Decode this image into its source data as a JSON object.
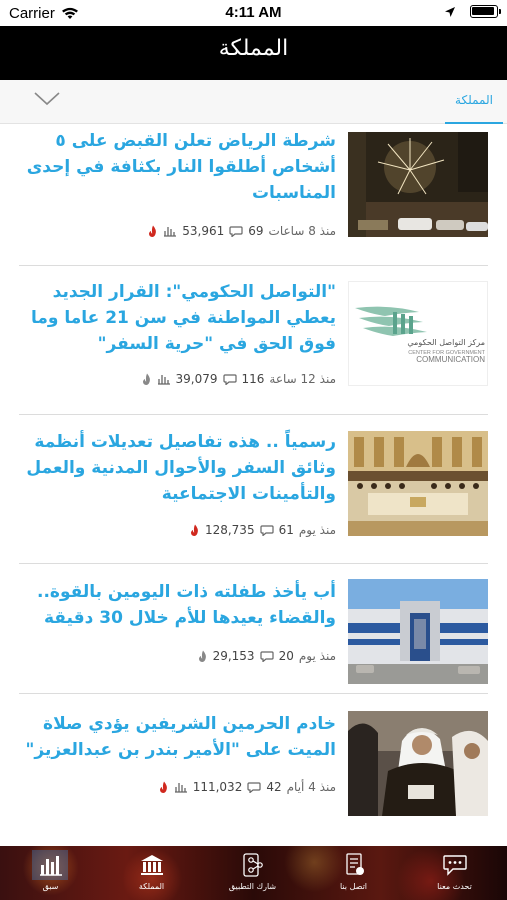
{
  "status_bar": {
    "carrier": "Carrier",
    "time": "4:11 AM"
  },
  "nav": {
    "title": "المملكة"
  },
  "tabs": {
    "active_label": "المملكة"
  },
  "accent_color": "#2aa6e0",
  "articles": [
    {
      "headline": "شرطة الرياض تعلن القبض على ٥ أشخاص أطلقوا النار بكثافة في إحدى المناسبات",
      "time": "منذ 8 ساعات",
      "comments": "69",
      "views": "53,961",
      "thumbnail": "night-celebration-fireworks"
    },
    {
      "headline": "\"التواصل الحكومي\": القرار الجديد يعطي المواطنة في سن 21 عاما وما فوق الحق في \"حرية السفر\"",
      "time": "منذ 12 ساعة",
      "comments": "116",
      "views": "39,079",
      "thumbnail": "center-for-government-communication-logo",
      "logo_text_ar": "مركز التواصل الحكومي",
      "logo_text_en1": "CENTER FOR GOVERNMENT",
      "logo_text_en2": "COMMUNICATION"
    },
    {
      "headline": "رسمياً .. هذه تفاصيل تعديلات أنظمة وثائق السفر والأحوال المدنية والعمل والتأمينات الاجتماعية",
      "time": "منذ يوم",
      "comments": "61",
      "views": "128,735",
      "thumbnail": "cabinet-meeting-hall"
    },
    {
      "headline": "أب يأخذ طفلته ذات اليومين بالقوة.. والقضاء يعيدها للأم خلال 30 دقيقة",
      "time": "منذ يوم",
      "comments": "20",
      "views": "29,153",
      "thumbnail": "court-building"
    },
    {
      "headline": "خادم الحرمين الشريفين يؤدي صلاة الميت على \"الأمير بندر بن عبدالعزيز\"",
      "time": "منذ 4 أيام",
      "comments": "42",
      "views": "111,032",
      "thumbnail": "king-funeral-prayer"
    }
  ],
  "bottom_tabs": [
    {
      "label": "سبق",
      "icon": "bar-chart-icon",
      "active": true
    },
    {
      "label": "المملكة",
      "icon": "bank-building-icon",
      "active": false
    },
    {
      "label": "شارك التطبيق",
      "icon": "share-nodes-icon",
      "active": false
    },
    {
      "label": "اتصل بنا",
      "icon": "contact-document-icon",
      "active": false
    },
    {
      "label": "تحدث معنا",
      "icon": "chat-bubble-icon",
      "active": false
    }
  ]
}
